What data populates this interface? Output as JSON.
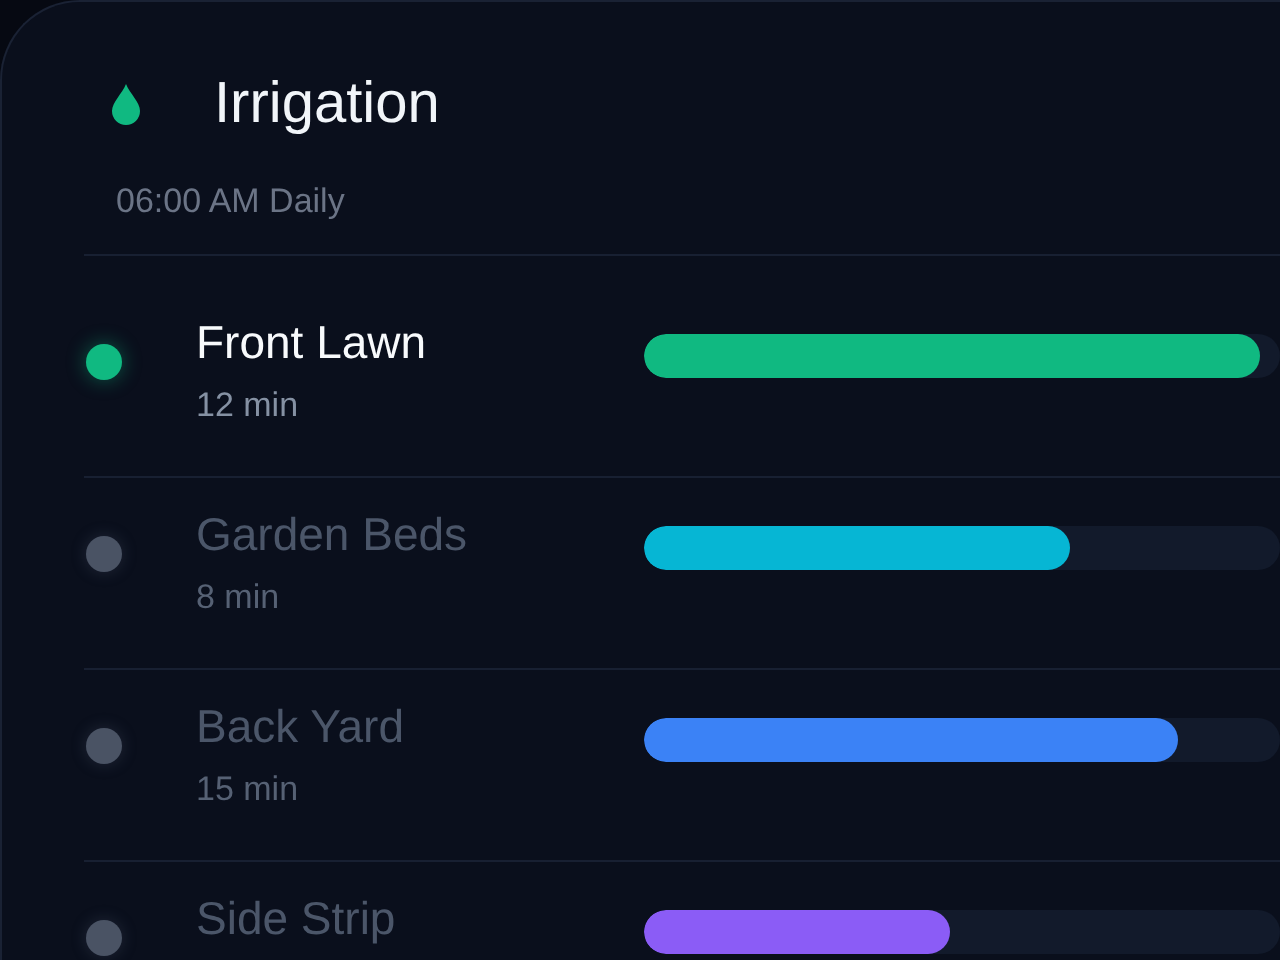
{
  "title": "Irrigation",
  "schedule": "06:00 AM Daily",
  "zones": [
    {
      "name": "Front Lawn",
      "duration": "12 min",
      "level": 0.97,
      "color": "#10b981",
      "selected": true
    },
    {
      "name": "Garden Beds",
      "duration": "8 min",
      "level": 0.67,
      "color": "#06b6d4",
      "selected": false
    },
    {
      "name": "Back Yard",
      "duration": "15 min",
      "level": 0.84,
      "color": "#3b82f6",
      "selected": false
    },
    {
      "name": "Side Strip",
      "level": 0.48,
      "color": "#8b5cf6",
      "selected": false
    }
  ]
}
